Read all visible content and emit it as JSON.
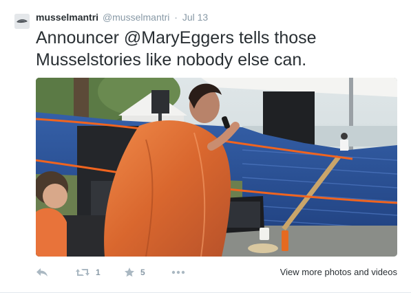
{
  "tweet": {
    "fullname": "musselmantri",
    "username": "@musselmantri",
    "separator": "·",
    "timestamp": "Jul 13",
    "text_before": "Announcer ",
    "mention": "@MaryEggers",
    "text_after": " tells those Musselstories like nobody else can."
  },
  "actions": {
    "reply_icon": "reply-icon",
    "retweet_icon": "retweet-icon",
    "retweet_count": "1",
    "favorite_icon": "star-icon",
    "favorite_count": "5",
    "more_icon": "more-dots-icon",
    "view_more_label": "View more photos and videos"
  },
  "colors": {
    "text": "#292f33",
    "secondary": "#8899a6",
    "icon": "#aab8c2",
    "poncho": "#e8733a",
    "fence": "#2b4f9a"
  }
}
